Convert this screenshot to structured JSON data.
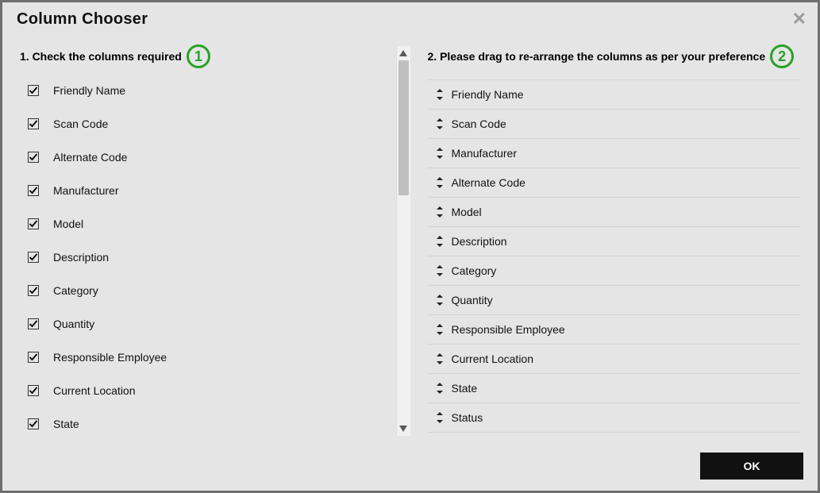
{
  "dialog": {
    "title": "Column Chooser",
    "okLabel": "OK"
  },
  "left": {
    "heading": "1. Check the columns required",
    "callout": "1",
    "items": [
      {
        "label": "Friendly Name",
        "checked": true
      },
      {
        "label": "Scan Code",
        "checked": true
      },
      {
        "label": "Alternate Code",
        "checked": true
      },
      {
        "label": "Manufacturer",
        "checked": true
      },
      {
        "label": "Model",
        "checked": true
      },
      {
        "label": "Description",
        "checked": true
      },
      {
        "label": "Category",
        "checked": true
      },
      {
        "label": "Quantity",
        "checked": true
      },
      {
        "label": "Responsible Employee",
        "checked": true
      },
      {
        "label": "Current Location",
        "checked": true
      },
      {
        "label": "State",
        "checked": true
      }
    ]
  },
  "right": {
    "heading": "2. Please drag to re-arrange the columns as per your preference",
    "callout": "2",
    "items": [
      {
        "label": "Friendly Name"
      },
      {
        "label": "Scan Code"
      },
      {
        "label": "Manufacturer"
      },
      {
        "label": "Alternate Code"
      },
      {
        "label": "Model"
      },
      {
        "label": "Description"
      },
      {
        "label": "Category"
      },
      {
        "label": "Quantity"
      },
      {
        "label": "Responsible Employee"
      },
      {
        "label": "Current Location"
      },
      {
        "label": "State"
      },
      {
        "label": "Status"
      }
    ]
  }
}
